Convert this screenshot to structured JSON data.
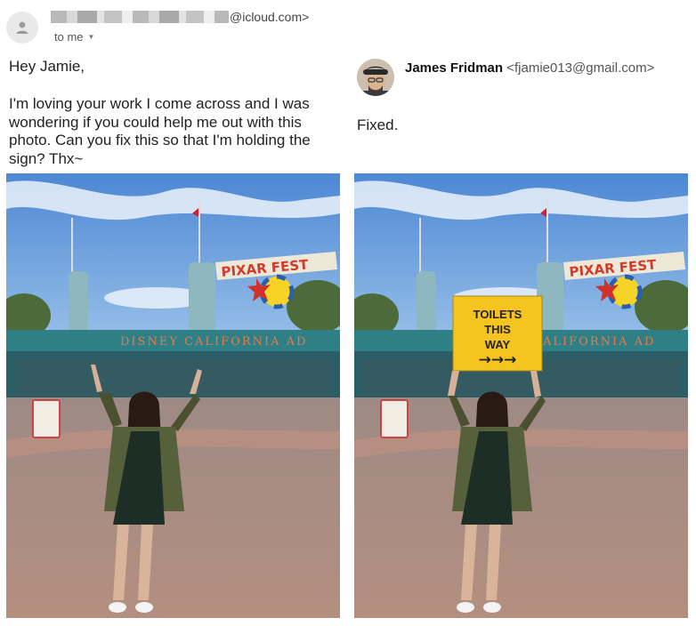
{
  "email": {
    "sender_domain": "@icloud.com>",
    "to_label": "to me",
    "greeting": "Hey Jamie,",
    "body": "I'm loving your work I come across and I was wondering if you could help me out with this photo. Can you fix this so that I'm holding the sign? Thx~"
  },
  "reply": {
    "sender_name": "James Fridman",
    "sender_email": "<fjamie013@gmail.com>",
    "body": "Fixed."
  },
  "photo": {
    "banner_text": "PIXAR FEST",
    "sign_text": "DISNEY CALIFORNIA AD",
    "held_sign": {
      "line1": "TOILETS",
      "line2": "THIS",
      "line3": "WAY",
      "arrows": "→→→"
    }
  },
  "colors": {
    "sky": "#6f9fd6",
    "canopy": "#2f7f86",
    "ground": "#a88a7c",
    "held_sign": "#f5c41f"
  }
}
